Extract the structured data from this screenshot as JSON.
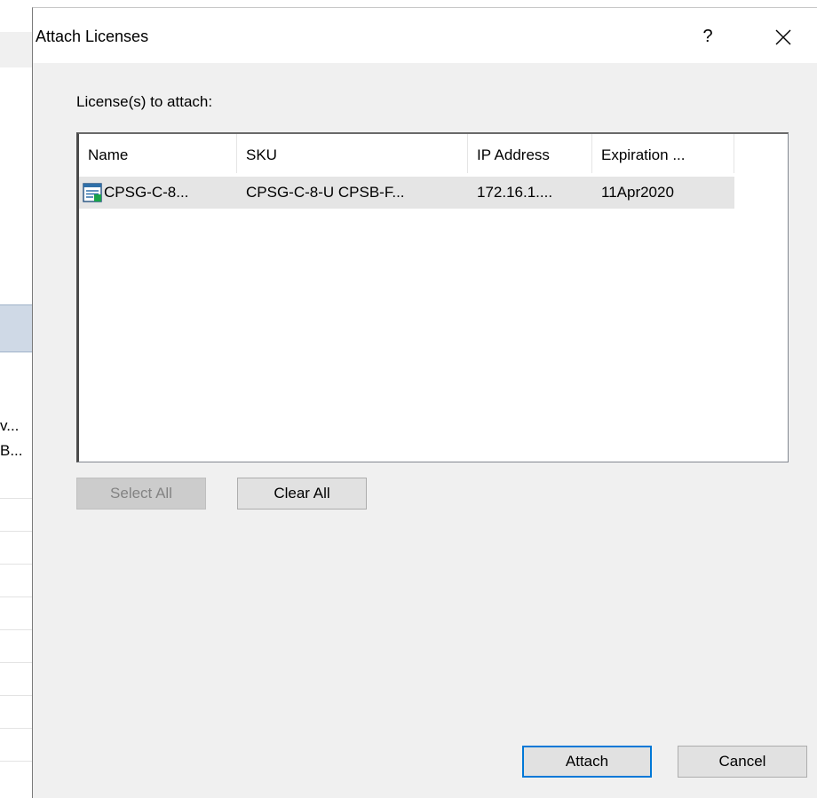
{
  "background": {
    "row_text_1": "v...",
    "row_text_2": "B..."
  },
  "dialog": {
    "title": "Attach Licenses",
    "help_label": "?",
    "list_label": "License(s) to attach:",
    "columns": [
      "Name",
      "SKU",
      "IP Address",
      "Expiration ..."
    ],
    "rows": [
      {
        "name": "CPSG-C-8...",
        "sku": "CPSG-C-8-U CPSB-F...",
        "ip": "172.16.1....",
        "expiration": "11Apr2020"
      }
    ],
    "select_all_label": "Select All",
    "clear_all_label": "Clear All",
    "attach_label": "Attach",
    "cancel_label": "Cancel"
  },
  "icons": {
    "close": "close-icon",
    "license": "license-icon"
  },
  "colors": {
    "dialog_bg": "#f0f0f0",
    "selection_bg": "#e5e5e5",
    "default_button_border": "#0078d7",
    "license_icon_green": "#1aa34a"
  }
}
